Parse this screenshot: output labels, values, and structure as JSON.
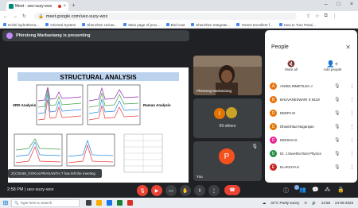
{
  "browser": {
    "tab_title": "Meet - uez-suzy-wox",
    "new_tab": "+",
    "tab_close": "×",
    "window_controls": [
      "–",
      "□",
      "×"
    ],
    "url": "meet.google.com/uez-suzy-wox",
    "bookmarks": [
      "Krishi hydrotherra...",
      "Oriental System",
      "Shenzhen Univer...",
      "Main page of prov...",
      "Bird cast",
      "Shenzhen Integrate...",
      "Yomez Excellent f...",
      "How to Turn Passi..."
    ]
  },
  "meeting": {
    "presenting_text": "Phirsteng Marbaniang is presenting",
    "code": "uez-suzy-wox",
    "time": "2:58 PM",
    "toast": "21CS048_GOKULPRASANTH T has left the meeting",
    "slide": {
      "title": "STRUCTURAL ANALYSIS",
      "left_label": "XRD Analysis :",
      "right_label": "Raman Analysis"
    },
    "tiles": {
      "presenter_name": "Phirsteng Marbaniang",
      "others": "69 others",
      "you_initial": "P",
      "you_label": "You"
    }
  },
  "people_panel": {
    "title": "People",
    "mute_all": "Mute all",
    "add_people": "Add people",
    "participants": [
      {
        "initial": "A",
        "name": "ANGELINMETILDA J",
        "color": "#e8710a"
      },
      {
        "initial": "B",
        "name": "BHUVANESWARI S 9422!",
        "color": "#e8710a"
      },
      {
        "initial": "D",
        "name": "DEEPA M",
        "color": "#e8710a"
      },
      {
        "initial": "D",
        "name": "Dhanishtaa Nagarajan",
        "color": "#e37400"
      },
      {
        "initial": "D",
        "name": "DINISHA D",
        "color": "#e52592"
      },
      {
        "initial": "D",
        "name": "Dr. J.Suvetha Rani Physics",
        "color": "#1e8e3e"
      },
      {
        "initial": "E",
        "name": "ELAKKIYA K",
        "color": "#c5221f"
      }
    ]
  },
  "taskbar": {
    "search_placeholder": "Type here to search",
    "weather": "34°C Partly sunny",
    "clock": "14:58",
    "date": "24-05-2023"
  }
}
